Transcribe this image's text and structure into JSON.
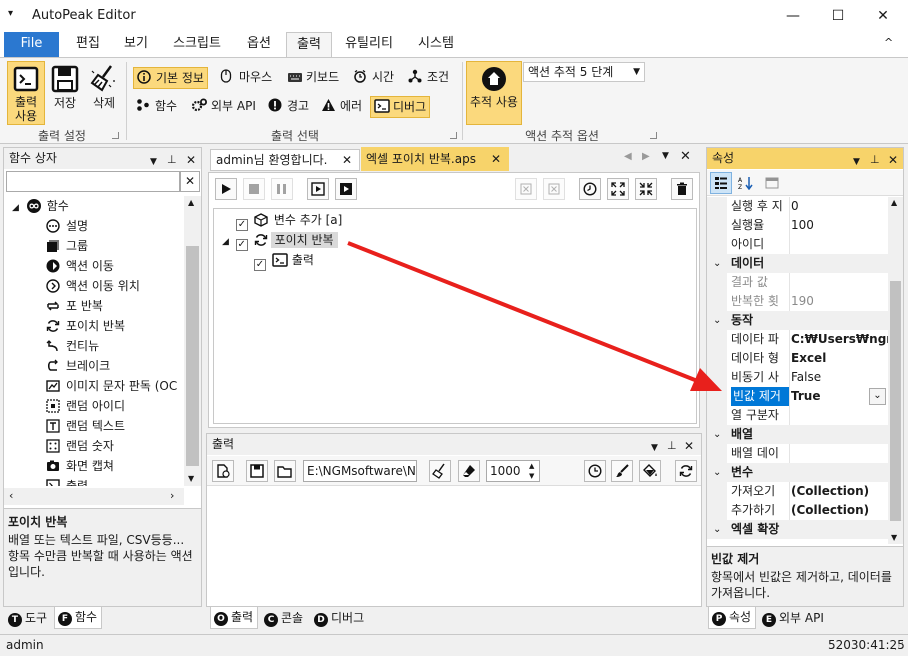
{
  "app": {
    "title": "AutoPeak Editor",
    "menu_glyph": "▾",
    "minimize": "—",
    "maximize": "☐",
    "close": "✕"
  },
  "ribbon_tabs": [
    "File",
    "편집",
    "보기",
    "스크립트",
    "옵션",
    "출력",
    "유틸리티",
    "시스템"
  ],
  "ribbon_collapse": "^",
  "ribbon": {
    "output_settings": {
      "label": "출력 설정",
      "use_output": "출력\n사용",
      "save": "저장",
      "delete": "삭제"
    },
    "output_select": {
      "label": "출력 선택",
      "basic_info": "기본 정보",
      "mouse": "마우스",
      "keyboard": "키보드",
      "time": "시간",
      "condition": "조건",
      "function": "함수",
      "external_api": "외부 API",
      "warning": "경고",
      "error": "에러",
      "debug": "디버그"
    },
    "action_trace": {
      "label": "액션 추적 옵션",
      "use_trace": "추적 사용",
      "trace_level": "액션 추적 5 단계"
    }
  },
  "function_panel": {
    "title": "함수 상자",
    "search_placeholder": "",
    "clear": "✕",
    "root": "함수",
    "items": [
      "설명",
      "그룹",
      "액션 이동",
      "액션 이동 위치",
      "포 반복",
      "포이치 반복",
      "컨티뉴",
      "브레이크",
      "이미지 문자 판독 (OC",
      "랜덤 아이디",
      "랜덤 텍스트",
      "랜덤 숫자",
      "화면 캡쳐",
      "출력"
    ],
    "desc_title": "포이치 반복",
    "desc_text": "배열 또는 텍스트 파일, CSV등등... 항목 수만큼 반복할 때 사용하는 액션입니다."
  },
  "left_bottom_tabs": [
    {
      "badge": "T",
      "label": "도구"
    },
    {
      "badge": "F",
      "label": "함수"
    }
  ],
  "editor": {
    "tabs": [
      {
        "label": "admin님 환영합니다.",
        "close": "✕"
      },
      {
        "label": "엑셀 포이치 반복.aps",
        "close": "✕"
      }
    ],
    "tree": [
      {
        "label": "변수 추가 [a]"
      },
      {
        "label": "포이치 반복"
      },
      {
        "label": "출력"
      }
    ]
  },
  "output_panel": {
    "title": "출력",
    "path": "E:\\NGMsoftware\\NG",
    "count": "1000"
  },
  "center_bottom_tabs": [
    {
      "badge": "O",
      "label": "출력"
    },
    {
      "badge": "C",
      "label": "콘솔"
    },
    {
      "badge": "D",
      "label": "디버그"
    }
  ],
  "properties": {
    "title": "속성",
    "rows": [
      {
        "name": "실행 후 지",
        "value": "0",
        "type": "normal"
      },
      {
        "name": "실행율",
        "value": "100",
        "type": "normal"
      },
      {
        "name": "아이디",
        "value": "",
        "type": "normal"
      },
      {
        "name": "데이터",
        "value": "",
        "type": "cat"
      },
      {
        "name": "결과 값",
        "value": "",
        "type": "dim"
      },
      {
        "name": "반복한 횟",
        "value": "190",
        "type": "dim"
      },
      {
        "name": "동작",
        "value": "",
        "type": "cat"
      },
      {
        "name": "데이타 파",
        "value": "C:₩Users₩ngma",
        "type": "bold"
      },
      {
        "name": "데이타 형",
        "value": "Excel",
        "type": "bold"
      },
      {
        "name": "비동기 사",
        "value": "False",
        "type": "normal"
      },
      {
        "name": "빈값 제거",
        "value": "True",
        "type": "selected"
      },
      {
        "name": "열 구분자",
        "value": "",
        "type": "normal"
      },
      {
        "name": "배열",
        "value": "",
        "type": "cat"
      },
      {
        "name": "배열 데이",
        "value": "",
        "type": "normal"
      },
      {
        "name": "변수",
        "value": "",
        "type": "cat"
      },
      {
        "name": "가져오기",
        "value": "(Collection)",
        "type": "bold"
      },
      {
        "name": "추가하기",
        "value": "(Collection)",
        "type": "bold"
      },
      {
        "name": "엑셀 확장",
        "value": "",
        "type": "cat"
      }
    ],
    "desc_title": "빈값 제거",
    "desc_text": "항목에서 빈값은 제거하고, 데이터를 가져옵니다."
  },
  "right_bottom_tabs": [
    {
      "badge": "P",
      "label": "속성"
    },
    {
      "badge": "E",
      "label": "외부 API"
    }
  ],
  "status": {
    "user": "admin",
    "time": "52030:41:25"
  },
  "colors": {
    "accent": "#2b78d0",
    "highlight": "#fbd97d",
    "panel_header_active": "#f7d36a",
    "selected_row": "#0078d7",
    "arrow": "#e8201c"
  }
}
